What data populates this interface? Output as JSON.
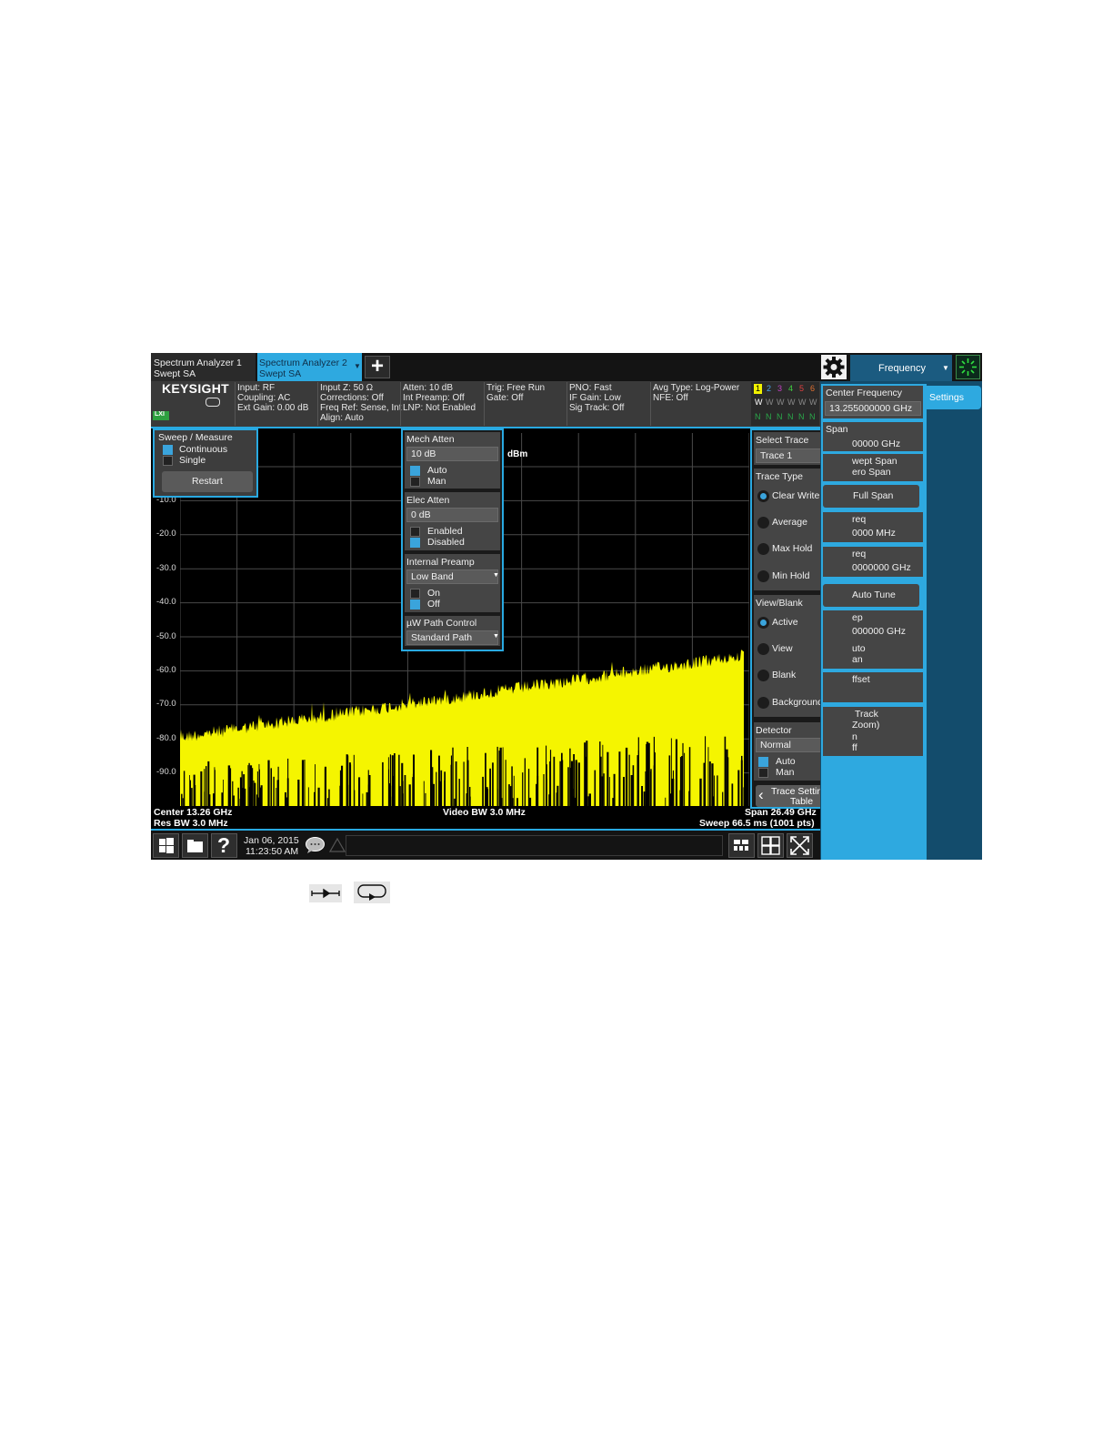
{
  "tabs": [
    {
      "title": "Spectrum Analyzer 1",
      "sub": "Swept SA"
    },
    {
      "title": "Spectrum Analyzer 2",
      "sub": "Swept SA"
    }
  ],
  "add_tab_label": "+",
  "menu_dropdown": "Frequency",
  "brand": "KEYSIGHT",
  "lxi": "LXI",
  "status": {
    "col1": [
      "Input: RF",
      "Coupling: AC",
      "Ext Gain: 0.00 dB"
    ],
    "col2": [
      "Input Z: 50 Ω",
      "Corrections: Off",
      "Freq Ref: Sense, Int",
      "Align: Auto"
    ],
    "col3": [
      "Atten: 10 dB",
      "Int Preamp: Off",
      "LNP: Not Enabled"
    ],
    "col4": [
      "Trig: Free Run",
      "Gate: Off"
    ],
    "col5": [
      "PNO: Fast",
      "IF Gain: Low",
      "Sig Track: Off"
    ],
    "col6": [
      "Avg Type: Log-Power",
      "NFE: Off"
    ]
  },
  "trace_indicator": {
    "numbers": [
      "1",
      "2",
      "3",
      "4",
      "5",
      "6"
    ],
    "types": [
      "W",
      "W",
      "W",
      "W",
      "W",
      "W"
    ],
    "dets": [
      "N",
      "N",
      "N",
      "N",
      "N",
      "N"
    ],
    "colors": [
      "#f2f200",
      "#4aa3e8",
      "#c040c0",
      "#40d040",
      "#e04040",
      "#e07030"
    ]
  },
  "sweep_panel": {
    "title": "Sweep / Measure",
    "continuous": "Continuous",
    "single": "Single",
    "restart": "Restart"
  },
  "atten_panel": {
    "mech_title": "Mech Atten",
    "mech_value": "10 dB",
    "auto": "Auto",
    "man": "Man",
    "elec_title": "Elec Atten",
    "elec_value": "0 dB",
    "enabled": "Enabled",
    "disabled": "Disabled",
    "preamp_title": "Internal Preamp",
    "preamp_value": "Low Band",
    "on": "On",
    "off": "Off",
    "uw_title": "µW Path Control",
    "uw_value": "Standard Path"
  },
  "trace_panel": {
    "select_title": "Select Trace",
    "select_value": "Trace 1",
    "type_title": "Trace Type",
    "types": [
      "Clear Write",
      "Average",
      "Max Hold",
      "Min Hold"
    ],
    "view_title": "View/Blank",
    "views": [
      "Active",
      "View",
      "Blank",
      "Background"
    ],
    "detector_title": "Detector",
    "detector_value": "Normal",
    "auto": "Auto",
    "man": "Man",
    "table_btn_1": "Trace Settings",
    "table_btn_2": "Table"
  },
  "freq_panel": {
    "center_title": "Center Frequency",
    "center_value": "13.255000000 GHz",
    "span_title": "Span",
    "span_value": "00000 GHz",
    "swept_span": "wept Span",
    "zero_span": "ero Span",
    "full_span": "Full Span",
    "start_title": "req",
    "start_value": "0000 MHz",
    "stop_title": "req",
    "stop_value": "0000000 GHz",
    "auto_tune": "Auto Tune",
    "step_title": "ep",
    "step_value": "000000 GHz",
    "step_auto": "uto",
    "step_man": "an",
    "offset": "ffset",
    "track_1": "Track",
    "track_2": "Zoom)",
    "track_on": "n",
    "track_off": "ff"
  },
  "settings_tab": "Settings",
  "graph": {
    "unit": "dBm",
    "yticks": [
      "-10.0",
      "-20.0",
      "-30.0",
      "-40.0",
      "-50.0",
      "-60.0",
      "-70.0",
      "-80.0",
      "-90.0"
    ],
    "center": "Center 13.26 GHz",
    "res_bw": "Res BW 3.0 MHz",
    "video_bw": "Video BW 3.0 MHz",
    "span": "Span 26.49 GHz",
    "sweep": "Sweep 66.5 ms (1001 pts)"
  },
  "taskbar": {
    "date": "Jan 06, 2015",
    "time": "11:23:50 AM",
    "help": "?"
  },
  "colors": {
    "accent": "#29a9e1",
    "trace": "#f5f500",
    "panel": "#3d3d3d",
    "sidebar": "#134c6c"
  }
}
